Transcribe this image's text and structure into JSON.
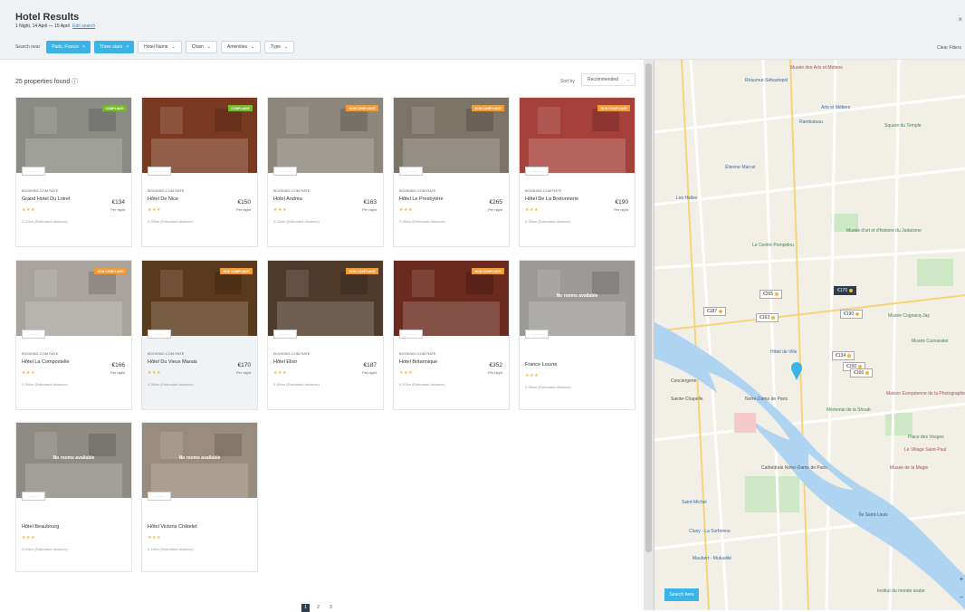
{
  "header": {
    "title": "Hotel Results",
    "subline": "1 Night, 14 April — 15 April",
    "edit_link": "Edit search",
    "close": "×",
    "search_near_label": "Search near",
    "active_filters": [
      {
        "label": "Paris, France",
        "remove": "×"
      },
      {
        "label": "Three stars",
        "remove": "×"
      }
    ],
    "dropdown_filters": [
      {
        "label": "Hotel Name",
        "chevron": "⌄"
      },
      {
        "label": "Chain",
        "chevron": "⌄"
      },
      {
        "label": "Amenities",
        "chevron": "⌄"
      },
      {
        "label": "Type",
        "chevron": "⌄"
      }
    ],
    "clear_filters": "Clear Filters"
  },
  "results": {
    "count_text": "25 properties found ⓘ",
    "sort_label": "Sort by",
    "sort_value": "Recommended",
    "sort_chevron": "⌄"
  },
  "hotels": [
    {
      "name": "Grand Hotel Du Loiret",
      "rate_source": "BOOKING.COM RATE",
      "price": "€134",
      "per_night": "Per night",
      "stars": "★★★",
      "distance": "0.22km (Estimated distance)",
      "badge": "COMPLIANT",
      "badge_type": "compliant",
      "photo_color": "#8b8b86",
      "placeholder": "- - - - -"
    },
    {
      "name": "Hôtel De Nice",
      "rate_source": "BOOKING.COM RATE",
      "price": "€150",
      "per_night": "Per night",
      "stars": "★★★",
      "distance": "0.25km (Estimated distance)",
      "badge": "COMPLIANT",
      "badge_type": "compliant",
      "photo_color": "#7a3a22",
      "placeholder": "- - - - -"
    },
    {
      "name": "Hotel Andréa",
      "rate_source": "BOOKING.COM RATE",
      "price": "€163",
      "per_night": "Per night",
      "stars": "★★★",
      "distance": "0.23km (Estimated distance)",
      "badge": "NON COMPLIANT",
      "badge_type": "non",
      "photo_color": "#8c877c",
      "placeholder": "- - - - -"
    },
    {
      "name": "Hôtel Le Presbytère",
      "rate_source": "BOOKING.COM RATE",
      "price": "€265",
      "per_night": "Per night",
      "stars": "★★★",
      "distance": "0.28km (Estimated distance)",
      "badge": "NON COMPLIANT",
      "badge_type": "non",
      "photo_color": "#7d7468",
      "placeholder": "- - - - -"
    },
    {
      "name": "Hôtel De La Bretonnerie",
      "rate_source": "BOOKING.COM RATE",
      "price": "€190",
      "per_night": "Per night",
      "stars": "★★★",
      "distance": "0.30km (Estimated distance)",
      "badge": "NON COMPLIANT",
      "badge_type": "non",
      "photo_color": "#a6403a",
      "placeholder": "- - - - -"
    },
    {
      "name": "Hôtel La Compostelle",
      "rate_source": "BOOKING.COM RATE",
      "price": "€166",
      "per_night": "Per night",
      "stars": "★★★",
      "distance": "0.35km (Estimated distance)",
      "badge": "NON COMPLIANT",
      "badge_type": "non",
      "photo_color": "#a8a39d",
      "placeholder": "- - - - -"
    },
    {
      "name": "Hôtel Du Vieux Marais",
      "rate_source": "BOOKING.COM RATE",
      "price": "€170",
      "per_night": "Per night",
      "stars": "★★★",
      "distance": "0.36km (Estimated distance)",
      "badge": "NON COMPLIANT",
      "badge_type": "non",
      "photo_color": "#5a3a1c",
      "placeholder": "- - - - -"
    },
    {
      "name": "Hôtel Elixir",
      "rate_source": "BOOKING.COM RATE",
      "price": "€187",
      "per_night": "Per night",
      "stars": "★★★",
      "distance": "0.46km (Estimated distance)",
      "badge": "NON COMPLIANT",
      "badge_type": "non",
      "photo_color": "#4e3b2a",
      "placeholder": "- - - - -"
    },
    {
      "name": "Hotel Britannique",
      "rate_source": "BOOKING.COM RATE",
      "price": "€352",
      "per_night": "Per night",
      "stars": "★★★",
      "distance": "0.47km (Estimated distance)",
      "badge": "NON COMPLIANT",
      "badge_type": "non",
      "photo_color": "#6a2a1e",
      "placeholder": "- - - - -"
    },
    {
      "name": "France Louvre",
      "stars": "★★★",
      "distance": "0.38km (Estimated distance)",
      "overlay": "No rooms available",
      "photo_color": "#9c9a96",
      "placeholder": "- - - - -"
    },
    {
      "name": "Hôtel Beaubourg",
      "stars": "★★★",
      "distance": "0.49km (Estimated distance)",
      "overlay": "No rooms available",
      "photo_color": "#8e8a84",
      "placeholder": "- - - - -"
    },
    {
      "name": "Hôtel Victoria Châtelet",
      "stars": "★★★",
      "distance": "0.49km (Estimated distance)",
      "overlay": "No rooms available",
      "photo_color": "#9a8c7c",
      "placeholder": "- - - - -"
    }
  ],
  "pagination": {
    "pages": [
      "1",
      "2",
      "3"
    ]
  },
  "map": {
    "search_here": "Search here",
    "zoom_in": "+",
    "zoom_out": "−",
    "place_labels": [
      {
        "text": "Musée des Arts et Métiers",
        "color": "pink"
      },
      {
        "text": "Rambuteau",
        "color": "blue"
      },
      {
        "text": "Étienne Marcel",
        "color": "blue"
      },
      {
        "text": "Les Halles",
        "color": "blue"
      },
      {
        "text": "Le Centre Pompidou",
        "color": "green"
      },
      {
        "text": "Musée d'art et d'histoire du Judaïsme",
        "color": "green"
      },
      {
        "text": "Musée Cognacq-Jay",
        "color": "green"
      },
      {
        "text": "Musée Carnavalet",
        "color": "green"
      },
      {
        "text": "Hôtel de Ville",
        "color": "blue"
      },
      {
        "text": "Notre-Dame de Paris",
        "color": "grey"
      },
      {
        "text": "Sainte-Chapelle",
        "color": "grey"
      },
      {
        "text": "Conciergerie",
        "color": "grey"
      },
      {
        "text": "Cathédrale Notre-Dame de Paris",
        "color": "grey"
      },
      {
        "text": "Île Saint-Louis",
        "color": "grey"
      },
      {
        "text": "Mémorial de la Shoah",
        "color": "green"
      },
      {
        "text": "Maison Européenne de la Photographie",
        "color": "pink"
      },
      {
        "text": "Place des Vosges",
        "color": "green"
      },
      {
        "text": "Le Village Saint-Paul",
        "color": "pink"
      },
      {
        "text": "Musée de la Magie",
        "color": "pink"
      },
      {
        "text": "Cluny - La Sorbonne",
        "color": "blue"
      },
      {
        "text": "Maubert - Mutualité",
        "color": "blue"
      },
      {
        "text": "Institut du monde arabe",
        "color": "green"
      },
      {
        "text": "Saint-Michel",
        "color": "blue"
      },
      {
        "text": "Réaumur-Sébastopol",
        "color": "blue"
      },
      {
        "text": "Arts et Métiers",
        "color": "blue"
      },
      {
        "text": "Square du Temple",
        "color": "green"
      }
    ],
    "price_markers": [
      {
        "label": "€163"
      },
      {
        "label": "€187"
      },
      {
        "label": "€265"
      },
      {
        "label": "€170"
      },
      {
        "label": "€190"
      },
      {
        "label": "€134"
      },
      {
        "label": "€150"
      },
      {
        "label": "€166"
      }
    ]
  }
}
